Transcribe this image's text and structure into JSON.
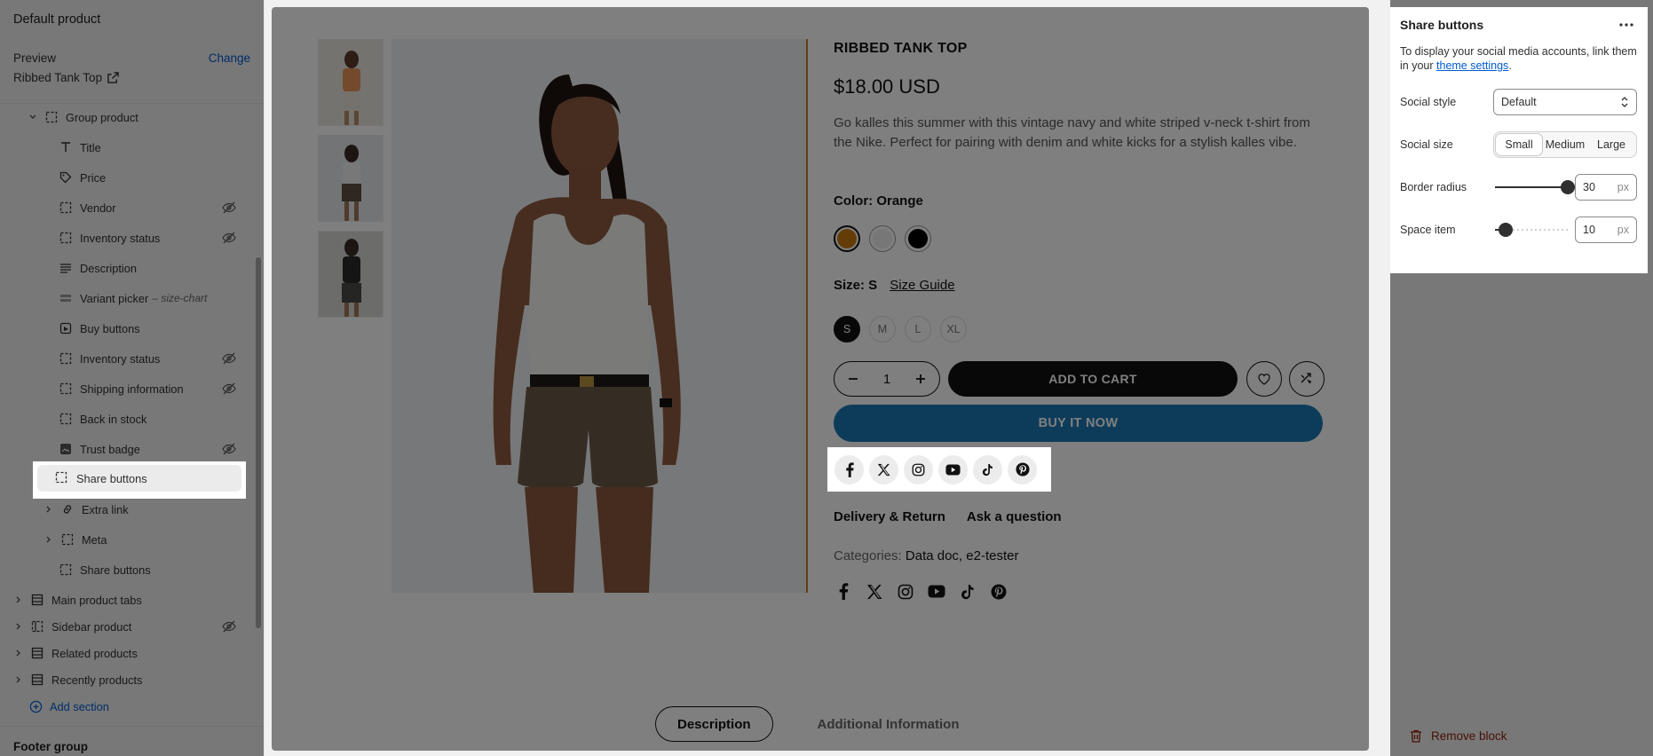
{
  "left": {
    "title": "Default product",
    "preview_label": "Preview",
    "change_label": "Change",
    "product_name": "Ribbed Tank Top",
    "tree": [
      {
        "label": "Group product",
        "icon": "block-icon",
        "chevron": "down",
        "indent": 1
      },
      {
        "label": "Title",
        "icon": "text-icon",
        "indent": 2
      },
      {
        "label": "Price",
        "icon": "price-tag-icon",
        "indent": 2
      },
      {
        "label": "Vendor",
        "icon": "block-icon",
        "indent": 2,
        "hidden": true
      },
      {
        "label": "Inventory status",
        "icon": "block-icon",
        "indent": 2,
        "hidden": true
      },
      {
        "label": "Description",
        "icon": "text-align-icon",
        "indent": 2
      },
      {
        "label": "Variant picker",
        "suffix": "size-chart",
        "icon": "variant-icon",
        "indent": 2
      },
      {
        "label": "Buy buttons",
        "icon": "buy-button-icon",
        "indent": 2
      },
      {
        "label": "Inventory status",
        "icon": "block-icon",
        "indent": 2,
        "hidden": true
      },
      {
        "label": "Shipping information",
        "icon": "block-icon",
        "indent": 2,
        "hidden": true
      },
      {
        "label": "Back in stock",
        "icon": "block-icon",
        "indent": 2
      },
      {
        "label": "Trust badge",
        "icon": "image-icon",
        "indent": 2,
        "hidden": true
      },
      {
        "label": "Share buttons",
        "icon": "block-icon",
        "indent": 2,
        "selected": true
      },
      {
        "label": "Extra link",
        "icon": "link-icon",
        "chevron": "right",
        "indent": 2
      },
      {
        "label": "Meta",
        "icon": "block-icon",
        "chevron": "right",
        "indent": 2
      },
      {
        "label": "Share buttons",
        "icon": "block-icon",
        "indent": 2
      },
      {
        "label": "Main product tabs",
        "icon": "section-icon",
        "chevron": "right",
        "indent": 0
      },
      {
        "label": "Sidebar product",
        "icon": "sidebar-icon",
        "chevron": "right",
        "indent": 0,
        "hidden": true
      },
      {
        "label": "Related products",
        "icon": "section-icon",
        "chevron": "right",
        "indent": 0
      },
      {
        "label": "Recently products",
        "icon": "section-icon",
        "chevron": "right",
        "indent": 0
      },
      {
        "label": "Add section",
        "icon": "plus-circle-icon",
        "indent": 0,
        "link": true
      }
    ],
    "footer_group": "Footer group"
  },
  "preview": {
    "product_title": "RIBBED TANK TOP",
    "price": "$18.00 USD",
    "description": "Go kalles this summer with this vintage navy and white striped v-neck t-shirt from the Nike. Perfect for pairing with denim and white kicks for a stylish kalles vibe.",
    "color_label": "Color: Orange",
    "colors": [
      "#c8780e",
      "#efefef",
      "#000000"
    ],
    "size_label": "Size: S",
    "size_guide": "Size Guide",
    "sizes": [
      "S",
      "M",
      "L",
      "XL"
    ],
    "quantity": "1",
    "add_to_cart": "ADD TO CART",
    "buy_now": "BUY IT NOW",
    "share_icons": [
      "facebook-icon",
      "x-icon",
      "instagram-icon",
      "youtube-icon",
      "tiktok-icon",
      "pinterest-icon"
    ],
    "delivery": "Delivery & Return",
    "ask": "Ask a question",
    "categories_label": "Categories:",
    "categories_value": "Data doc, e2-tester",
    "tab_description": "Description",
    "tab_additional": "Additional Information"
  },
  "right": {
    "title": "Share buttons",
    "info_prefix": "To display your social media accounts, link them in your",
    "info_link": "theme settings",
    "info_suffix": ".",
    "social_style_label": "Social style",
    "social_style_value": "Default",
    "social_size_label": "Social size",
    "social_size_options": [
      "Small",
      "Medium",
      "Large"
    ],
    "social_size_selected": "Small",
    "border_radius_label": "Border radius",
    "border_radius_value": "30",
    "border_radius_fraction": 1.0,
    "space_item_label": "Space item",
    "space_item_value": "10",
    "space_item_fraction": 0.15,
    "unit": "px",
    "remove_block": "Remove block"
  },
  "colors": {
    "accent_link": "#005bd3",
    "buy_now_bg": "#1b78b5",
    "danger": "#8e1f0b"
  }
}
